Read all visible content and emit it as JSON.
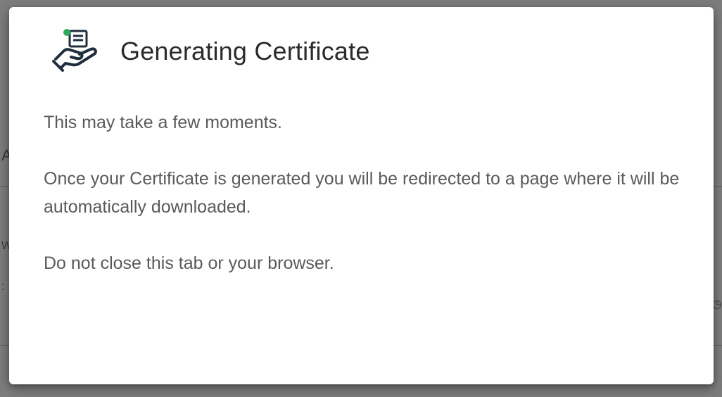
{
  "dialog": {
    "icon": "certificate-hand-icon",
    "title": "Generating Certificate",
    "paragraphs": [
      "This may take a few moments.",
      "Once your Certificate is generated you will be redirected to a page where it will be automatically downloaded.",
      "Do not close this tab or your browser."
    ]
  },
  "colors": {
    "overlay": "#7d7d7d",
    "dialog_background": "#ffffff",
    "title_text": "#2b2b2b",
    "body_text": "#5a5a5a",
    "icon_primary": "#1f2d3d",
    "icon_accent": "#2eaa5c"
  }
}
